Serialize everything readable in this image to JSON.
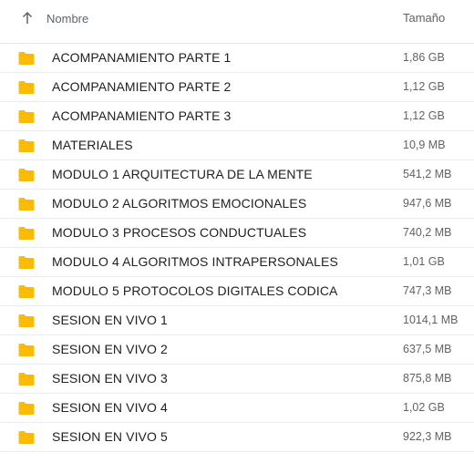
{
  "header": {
    "name_label": "Nombre",
    "size_label": "Tamaño",
    "sort_icon": "arrow-up-icon"
  },
  "colors": {
    "folder": "#fbbc04",
    "folder_tab": "#f9ab00"
  },
  "files": [
    {
      "name": "ACOMPANAMIENTO PARTE 1",
      "size": "1,86 GB"
    },
    {
      "name": "ACOMPANAMIENTO PARTE 2",
      "size": "1,12 GB"
    },
    {
      "name": "ACOMPANAMIENTO PARTE 3",
      "size": "1,12 GB"
    },
    {
      "name": "MATERIALES",
      "size": "10,9 MB"
    },
    {
      "name": "MODULO 1 ARQUITECTURA DE LA MENTE",
      "size": "541,2 MB"
    },
    {
      "name": "MODULO 2 ALGORITMOS EMOCIONALES",
      "size": "947,6 MB"
    },
    {
      "name": "MODULO 3 PROCESOS CONDUCTUALES",
      "size": "740,2 MB"
    },
    {
      "name": "MODULO 4 ALGORITMOS INTRAPERSONALES",
      "size": "1,01 GB"
    },
    {
      "name": "MODULO 5 PROTOCOLOS DIGITALES CODICA",
      "size": "747,3 MB"
    },
    {
      "name": "SESION EN VIVO 1",
      "size": "1014,1 MB"
    },
    {
      "name": "SESION EN VIVO 2",
      "size": "637,5 MB"
    },
    {
      "name": "SESION EN VIVO 3",
      "size": "875,8 MB"
    },
    {
      "name": "SESION EN VIVO 4",
      "size": "1,02 GB"
    },
    {
      "name": "SESION EN VIVO 5",
      "size": "922,3 MB"
    }
  ]
}
